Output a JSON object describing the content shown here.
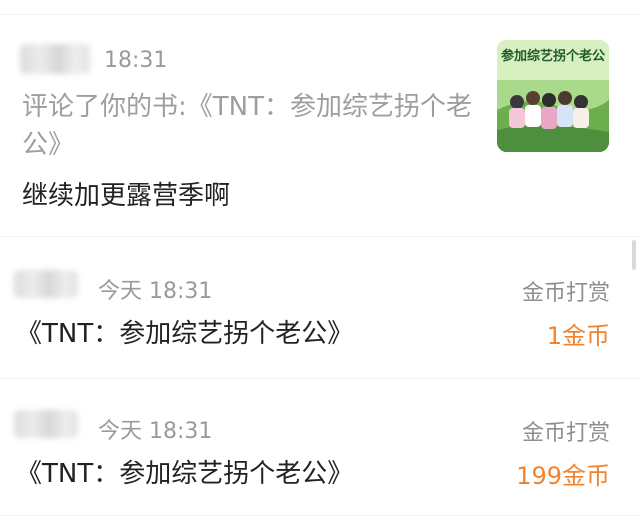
{
  "comment": {
    "time": "18:31",
    "action_text": "评论了你的书:《TNT：参加综艺拐个老公》",
    "content": "继续加更露营季啊"
  },
  "book_cover": {
    "cover_title": "参加综艺拐个老公"
  },
  "rewards": [
    {
      "time": "今天 18:31",
      "type": "金币打赏",
      "book_title": "《TNT：参加综艺拐个老公》",
      "amount": "1金币"
    },
    {
      "time": "今天 18:31",
      "type": "金币打赏",
      "book_title": "《TNT：参加综艺拐个老公》",
      "amount": "199金币"
    }
  ],
  "colors": {
    "accent_orange": "#f0832e",
    "muted_text": "#9a9a9a",
    "primary_text": "#222222"
  }
}
